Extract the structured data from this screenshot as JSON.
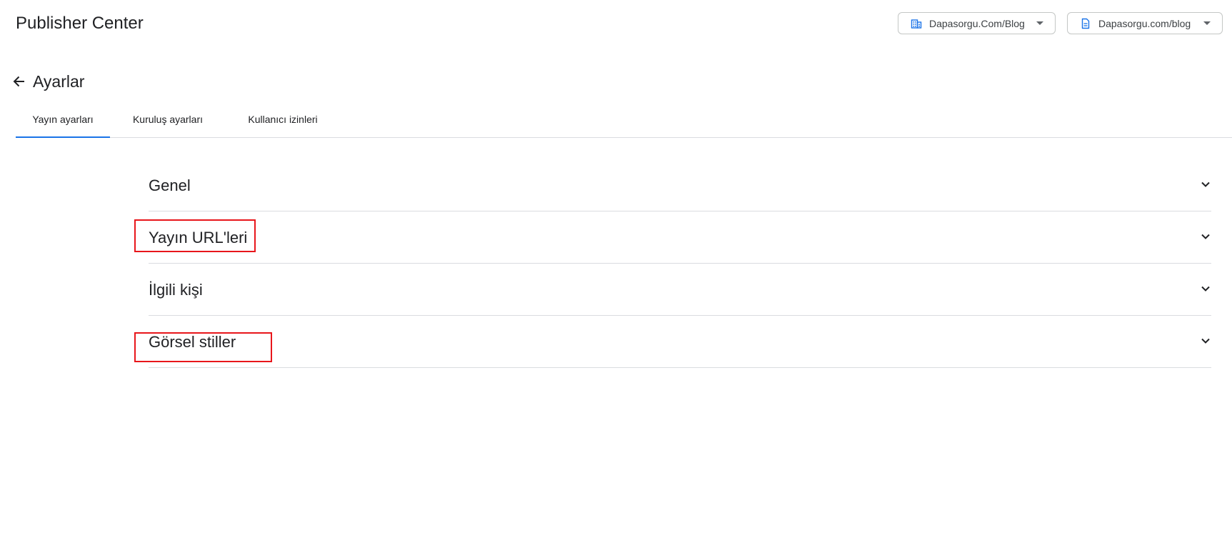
{
  "header": {
    "brand": "Publisher Center",
    "org_picker": {
      "label": "Dapasorgu.Com/Blog",
      "icon": "building-icon"
    },
    "pub_picker": {
      "label": "Dapasorgu.com/blog",
      "icon": "document-icon"
    }
  },
  "page": {
    "title": "Ayarlar",
    "back_icon": "arrow-back-icon"
  },
  "tabs": [
    {
      "label": "Yayın ayarları",
      "active": true
    },
    {
      "label": "Kuruluş ayarları",
      "active": false
    },
    {
      "label": "Kullanıcı izinleri",
      "active": false
    }
  ],
  "sections": [
    {
      "label": "Genel",
      "icon": "chevron-down-icon"
    },
    {
      "label": "Yayın URL'leri",
      "icon": "chevron-down-icon",
      "highlighted": true
    },
    {
      "label": "İlgili kişi",
      "icon": "chevron-down-icon"
    },
    {
      "label": "Görsel stiller",
      "icon": "chevron-down-icon",
      "highlighted": true
    }
  ],
  "colors": {
    "accent": "#1a73e8",
    "highlight": "#e8161b",
    "divider": "#dadce0"
  }
}
